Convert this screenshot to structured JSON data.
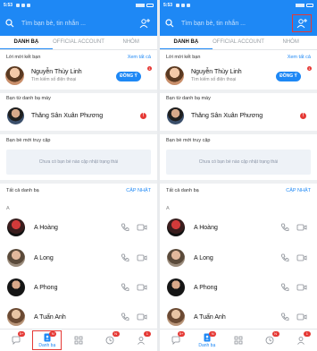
{
  "status_time": "5:53",
  "search": {
    "placeholder": "Tìm bạn bè, tin nhắn ..."
  },
  "tabs": [
    "DANH BẠ",
    "OFFICIAL ACCOUNT",
    "NHÓM"
  ],
  "requests": {
    "label": "Lời mời kết bạn",
    "see_all": "Xem tất cả",
    "see_all_count": "1",
    "name": "Nguyễn Thùy Linh",
    "subtitle": "Tìm kiếm số điện thoại",
    "accept_label": "ĐỒNG Ý"
  },
  "phonebook": {
    "label": "Bạn từ danh bạ máy",
    "name": "Thăng Sân Xuân Phương",
    "alert": "!"
  },
  "recent": {
    "label": "Bạn bè mới truy cập",
    "empty_text": "Chưa có bạn bè nào cập nhật trạng thái"
  },
  "all_contacts": {
    "label": "Tất cả danh bạ",
    "update_label": "CẬP NHẬT",
    "letter": "A",
    "contacts": [
      {
        "name": "A Hoàng"
      },
      {
        "name": "A Long"
      },
      {
        "name": "A Phong"
      },
      {
        "name": "A Tuấn Anh"
      }
    ]
  },
  "nav": {
    "badges": [
      "5+",
      "N",
      "N",
      "N",
      "1"
    ],
    "contacts_label": "Danh bạ"
  },
  "colors": {
    "accent": "#1e88f5",
    "highlight": "#e53935"
  }
}
